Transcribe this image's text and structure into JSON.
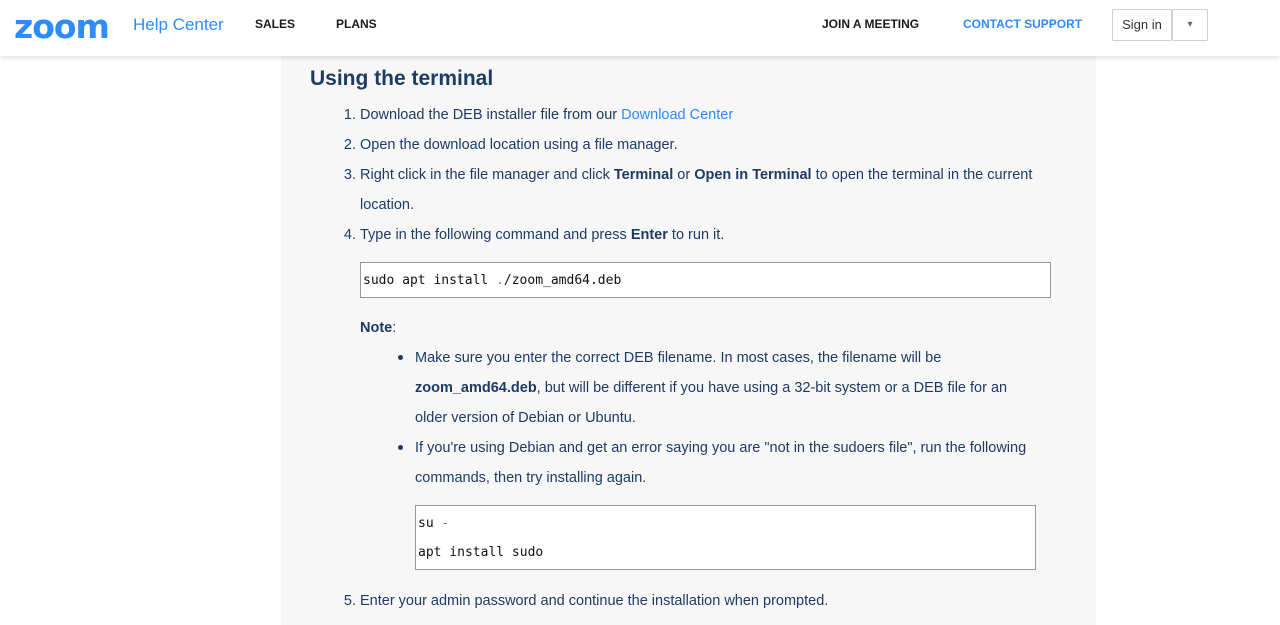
{
  "header": {
    "logo": "zoom",
    "help_center": "Help Center",
    "nav": {
      "sales": "SALES",
      "plans": "PLANS",
      "join": "JOIN A MEETING",
      "contact": "CONTACT SUPPORT"
    },
    "signin": "Sign in",
    "dropdown_glyph": "▾"
  },
  "content": {
    "heading": "Using the terminal",
    "step1": {
      "num": "1.",
      "text": "Download the DEB installer file from our ",
      "link": "Download Center"
    },
    "step2": {
      "num": "2.",
      "text": "Open the download location using a file manager."
    },
    "step3": {
      "num": "3.",
      "t1": "Right click in the file manager and click ",
      "b1": "Terminal",
      "t2": " or ",
      "b2": "Open in Terminal",
      "t3": " to open the terminal in the current",
      "t4": "location."
    },
    "step4": {
      "num": "4.",
      "t1": "Type in the following command and press ",
      "b1": "Enter",
      "t2": " to run it."
    },
    "code1": {
      "p1": "sudo apt install ",
      "p2": ".",
      "p3": "/zoom_amd64",
      "p4": ".deb"
    },
    "note_label": "Note",
    "note_colon": ":",
    "bullet1": {
      "l1": "Make sure you enter the correct DEB filename. In most cases, the filename will be",
      "b1": "zoom_amd64.deb",
      "l2": ", but will be different if you have using a 32-bit system or a DEB file for an",
      "l3": "older version of Debian or Ubuntu."
    },
    "bullet2": {
      "l1": "If you're using Debian and get an error saying you are \"not in the sudoers file\", run the following",
      "l2": "commands, then try installing again."
    },
    "code2": {
      "line1a": "su ",
      "line1b": "-",
      "line2": "apt install sudo"
    },
    "step5": {
      "num": "5.",
      "text": "Enter your admin password and continue the installation when prompted."
    }
  },
  "colors": {
    "brand": "#2d8cff",
    "text": "#1f3b64",
    "panel": "#f7f7f8"
  }
}
